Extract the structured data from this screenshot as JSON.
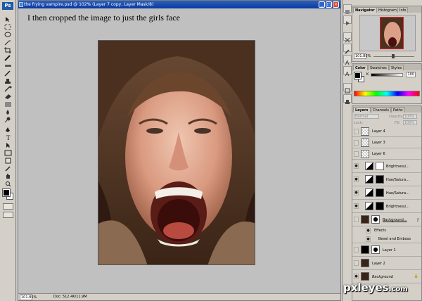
{
  "document": {
    "title": "the frying vampire.psd @ 102% (Layer 7 copy, Layer Mask/8)",
    "caption": "I then cropped the image to just the girls face",
    "zoom": "101.85%",
    "doc_size": "Doc: 512.4K/11.9M"
  },
  "toolbox": {
    "logo": "Ps"
  },
  "navigator": {
    "tabs": [
      "Navigator",
      "Histogram",
      "Info"
    ],
    "zoom": "101.85%",
    "zoom_fraction": 0.85
  },
  "color": {
    "tabs": [
      "Color",
      "Swatches",
      "Styles"
    ],
    "channel": "K",
    "value": "100"
  },
  "layers_panel": {
    "tabs": [
      "Layers",
      "Channels",
      "Paths"
    ],
    "blend_mode": "Normal",
    "opacity_label": "Opacity:",
    "opacity_value": "100%",
    "lock_label": "Lock:",
    "fill_label": "Fill:",
    "fill_value": "100%",
    "layers": [
      {
        "name": "Layer 4",
        "visible": false,
        "thumb": "check"
      },
      {
        "name": "Layer 3",
        "visible": false,
        "thumb": "check"
      },
      {
        "name": "Layer 6",
        "visible": false,
        "thumb": "check"
      },
      {
        "name": "Brightness/...",
        "visible": true,
        "thumb": "adj"
      },
      {
        "name": "Hue/Satura...",
        "visible": true,
        "thumb": "adj"
      },
      {
        "name": "Hue/Satura...",
        "visible": true,
        "thumb": "adj"
      },
      {
        "name": "Brightness/...",
        "visible": true,
        "thumb": "adj"
      },
      {
        "name": "Background...",
        "visible": false,
        "thumb": "face"
      },
      {
        "name": "Effects",
        "visible": true,
        "thumb": "none"
      },
      {
        "name": "Bevel and Emboss",
        "visible": true,
        "thumb": "none"
      },
      {
        "name": "Layer 1",
        "visible": false,
        "thumb": "black"
      },
      {
        "name": "Layer 2",
        "visible": false,
        "thumb": "dark"
      },
      {
        "name": "Background",
        "visible": true,
        "thumb": "face"
      }
    ]
  },
  "watermark": {
    "text": "pxleyes",
    "suffix": ".com"
  }
}
